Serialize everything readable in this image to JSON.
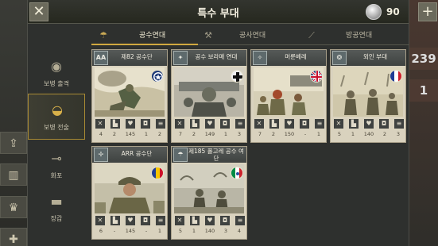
{
  "header": {
    "title": "특수 부대",
    "medal_count": "90"
  },
  "tabs": [
    {
      "label": "공수연대",
      "active": true,
      "icon": "parachute-icon"
    },
    {
      "label": "공사연대",
      "active": false,
      "icon": "shovel-icon"
    },
    {
      "label": "방공연대",
      "active": false,
      "icon": "aa-gun-icon"
    }
  ],
  "sidebar": {
    "items": [
      {
        "label": "보병 출격",
        "active": false,
        "icon": "infantry-icon"
      },
      {
        "label": "보병 전술",
        "active": true,
        "icon": "helmet-icon"
      },
      {
        "label": "화포",
        "active": false,
        "icon": "artillery-icon"
      },
      {
        "label": "장갑",
        "active": false,
        "icon": "tank-icon"
      }
    ]
  },
  "right_edge": {
    "numbers": [
      "239",
      "1"
    ]
  },
  "cards": [
    {
      "name": "제82 공수단",
      "badge": "AA",
      "flag": "usa-flag",
      "stats": [
        "4",
        "2",
        "145",
        "1",
        "2"
      ]
    },
    {
      "name": "공수 보라매 연대",
      "badge": "",
      "flag": "germany-flag",
      "stats": [
        "7",
        "2",
        "149",
        "1",
        "3"
      ]
    },
    {
      "name": "머룬베레",
      "badge": "",
      "flag": "uk-flag",
      "stats": [
        "7",
        "2",
        "150",
        "-",
        "1"
      ]
    },
    {
      "name": "외인 부대",
      "badge": "",
      "flag": "france-flag",
      "stats": [
        "5",
        "1",
        "140",
        "2",
        "3"
      ]
    },
    {
      "name": "ARR 공수단",
      "badge": "",
      "flag": "romania-flag",
      "stats": [
        "6",
        "-",
        "145",
        "-",
        "1"
      ]
    },
    {
      "name": "제185 폴고레 공수 여단",
      "badge": "",
      "flag": "italy-flag",
      "stats": [
        "5",
        "1",
        "140",
        "3",
        "4"
      ]
    }
  ],
  "colors": {
    "accent_gold": "#d0a840",
    "panel_bg": "#2e302e",
    "card_bg": "#d9d2be"
  }
}
